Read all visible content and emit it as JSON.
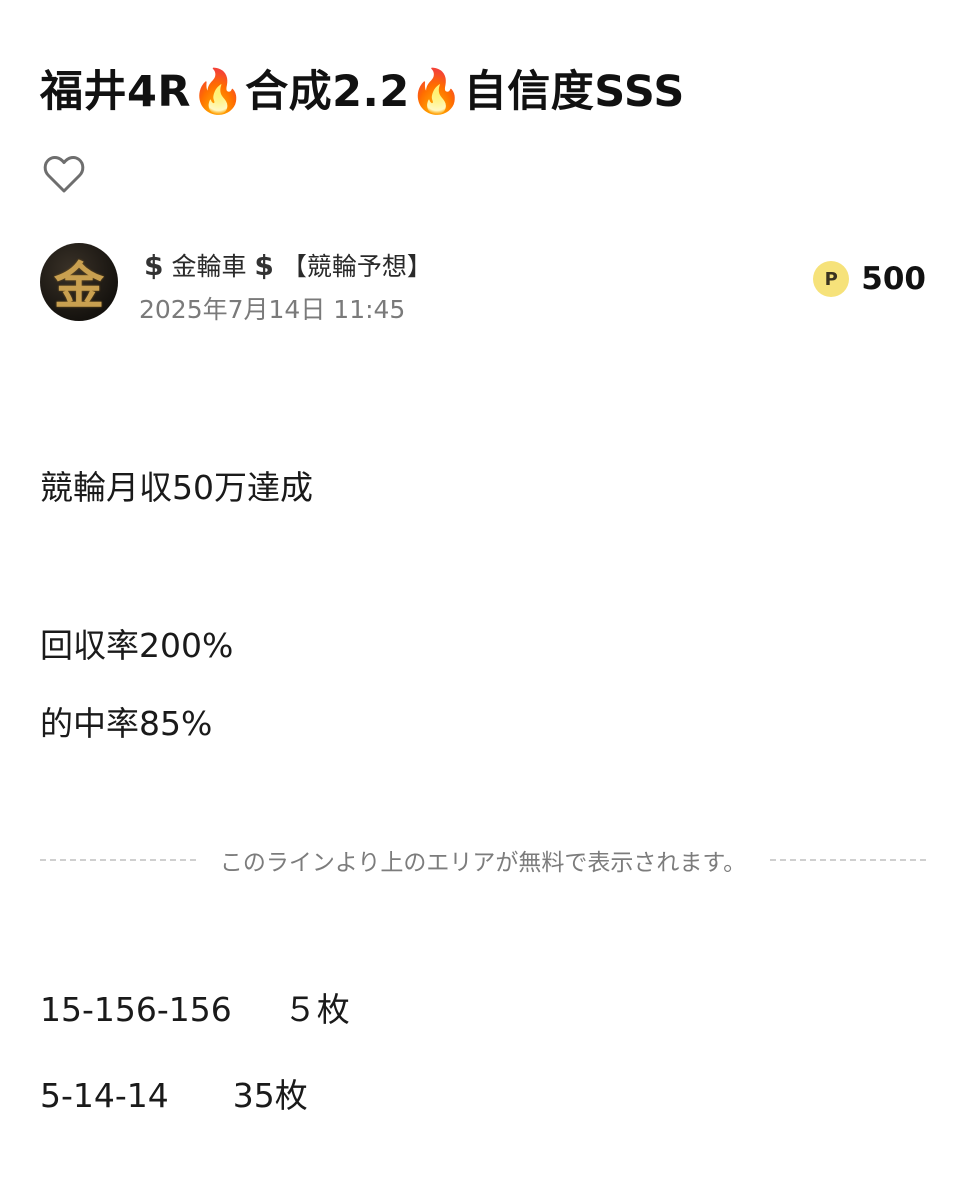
{
  "post": {
    "title": "福井4R🔥合成2.2🔥自信度SSS",
    "like_icon": "heart-outline-icon"
  },
  "author": {
    "avatar_icon": "gold-kanji-avatar",
    "avatar_glyph": "金",
    "name_prefix": "$",
    "name_main": "金輪車",
    "name_suffix": "$",
    "name_tag": "【競輪予想】",
    "date": "2025年7月14日 11:45"
  },
  "price": {
    "badge": "P",
    "value": "500",
    "badge_color": "#f6e27a"
  },
  "content": {
    "line1": "競輪月収50万達成",
    "line2": "回収率200%",
    "line3": "的中率85%",
    "paywall_notice": "このラインより上のエリアが無料で表示されます。",
    "bet1_combo": "15-156-156",
    "bet1_qty": "５枚",
    "bet2_combo": "5-14-14",
    "bet2_qty": "35枚"
  }
}
